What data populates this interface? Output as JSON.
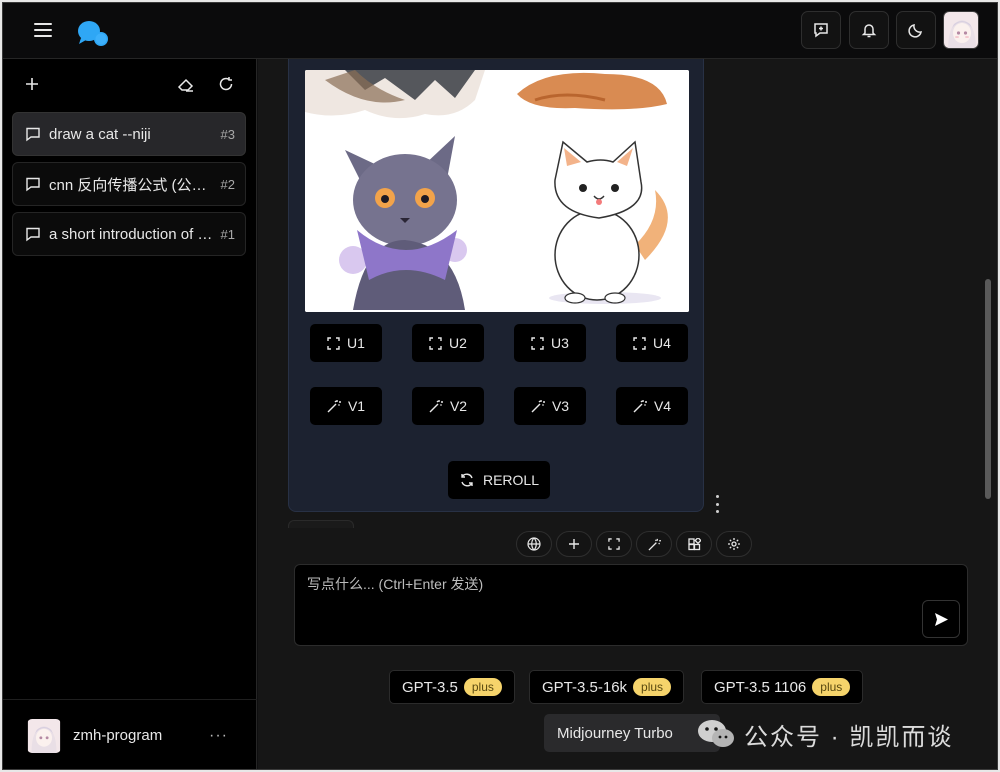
{
  "header": {
    "menu_icon": "hamburger-menu-icon",
    "logo_icon": "chat-bubbles-logo",
    "buttons": [
      "new-chat-icon",
      "bell-icon",
      "moon-icon"
    ],
    "accent": "#2fa7f5"
  },
  "sidebar": {
    "tools": [
      "plus-icon",
      "eraser-icon",
      "refresh-icon"
    ],
    "conversations": [
      {
        "title": "draw a cat --niji",
        "num": "#3",
        "active": true
      },
      {
        "title": "cnn 反向传播公式 (公式使用latex)",
        "num": "#2",
        "active": false
      },
      {
        "title": "a short introduction of cnn",
        "num": "#1",
        "active": false
      }
    ],
    "user": {
      "name": "zmh-program",
      "more": "···"
    }
  },
  "message": {
    "upscale_buttons": [
      "U1",
      "U2",
      "U3",
      "U4"
    ],
    "variation_buttons": [
      "V1",
      "V2",
      "V3",
      "V4"
    ],
    "reroll_label": "REROLL"
  },
  "toolbar": {
    "icons": [
      "globe-icon",
      "plus-icon",
      "expand-icon",
      "magic-wand-icon",
      "apps-icon",
      "settings-icon"
    ]
  },
  "composer": {
    "placeholder": "写点什么... (Ctrl+Enter 发送)",
    "value": "",
    "send_icon": "send-icon"
  },
  "models": [
    {
      "label": "GPT-3.5",
      "badge": "plus"
    },
    {
      "label": "GPT-3.5-16k",
      "badge": "plus"
    },
    {
      "label": "GPT-3.5 1106",
      "badge": "plus"
    }
  ],
  "model_extra": {
    "label": "Midjourney Turbo"
  },
  "watermark": {
    "text": "公众号 · 凯凯而谈",
    "icon": "wechat-icon"
  }
}
